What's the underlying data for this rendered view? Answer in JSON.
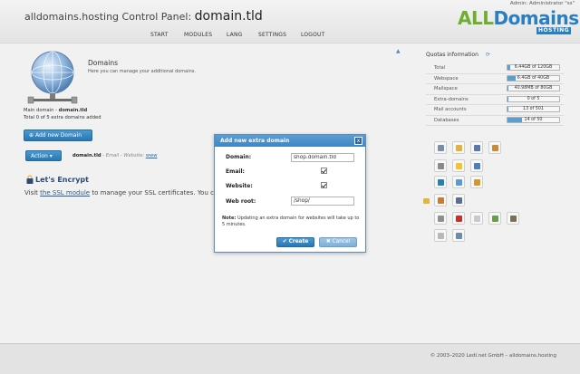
{
  "header": {
    "title_prefix": "alldomains.hosting Control Panel:",
    "title_domain": "domain.tld",
    "user_info": "Admin: Administrator \"ss\"",
    "logo_part1": "ALL",
    "logo_part2": "Domains",
    "logo_sub": "HOSTING"
  },
  "nav": {
    "items": [
      "START",
      "MODULES",
      "LANG",
      "SETTINGS",
      "LOGOUT"
    ]
  },
  "domains": {
    "title": "Domains",
    "description": "Here you can manage your additional domains.",
    "main_domain_label": "Main domain -",
    "main_domain_value": "domain.tld",
    "total_line": "Total 0 of 5 extra domains added",
    "add_button": "Add new Domain",
    "action_button": "Action",
    "row_domain": "domain.tld",
    "row_meta": "- Email - Website:",
    "row_www": "www"
  },
  "letsencrypt": {
    "title": "Let's Encrypt",
    "text_prefix": "Visit",
    "link": "the SSL module",
    "text_suffix": "to manage your SSL certificates. You can"
  },
  "quotas": {
    "title": "Quotas information",
    "rows": [
      {
        "label": "Total",
        "value": "6.44GB of 120GB",
        "fill": 0.054
      },
      {
        "label": "Webspace",
        "value": "6.4GB of 40GB",
        "fill": 0.16
      },
      {
        "label": "Mailspace",
        "value": "40.98MB of 80GB",
        "fill": 0.005
      },
      {
        "label": "Extra-domains",
        "value": "0 of 5",
        "fill": 0.0
      },
      {
        "label": "Mail accounts",
        "value": "13 of 501",
        "fill": 0.026
      },
      {
        "label": "Databases",
        "value": "14 of 50",
        "fill": 0.28
      }
    ]
  },
  "tools": [
    {
      "name": "users-icon",
      "color": "#7a8fa6"
    },
    {
      "name": "folder-icon",
      "color": "#e2b23d"
    },
    {
      "name": "settings-icon",
      "color": "#5a78a8"
    },
    {
      "name": "package-icon",
      "color": "#c98a3a"
    },
    {
      "name": "tools-icon",
      "color": "#8a8a8a"
    },
    {
      "name": "bulb-icon",
      "color": "#f2c530"
    },
    {
      "name": "network-icon",
      "color": "#4d7fb8"
    },
    {
      "name": "wordpress-icon",
      "color": "#2b7fb0"
    },
    {
      "name": "globe-icon",
      "color": "#5b9bd5"
    },
    {
      "name": "lock-icon",
      "color": "#d09a2a"
    },
    {
      "name": "paint-icon",
      "color": "#c77b35"
    },
    {
      "name": "blocks-icon",
      "color": "#5a6f8e"
    },
    {
      "name": "database-icon",
      "color": "#8e8e8e"
    },
    {
      "name": "delete-icon",
      "color": "#c8302c"
    },
    {
      "name": "document-icon",
      "color": "#c9c9c9"
    },
    {
      "name": "chart-icon",
      "color": "#6a9d4a"
    },
    {
      "name": "image-icon",
      "color": "#7b6f56"
    },
    {
      "name": "notes-icon",
      "color": "#b8b8b8"
    },
    {
      "name": "search-icon",
      "color": "#6a8cae"
    }
  ],
  "footer": {
    "copyright": "© 2003–2020 LedI.net GmbH – alldomains.hosting"
  },
  "modal": {
    "title": "Add new extra domain",
    "close": "x",
    "domain_label": "Domain:",
    "domain_value": "shop.domain.tld",
    "email_label": "Email:",
    "website_label": "Website:",
    "webroot_label": "Web root:",
    "webroot_value": "/shop/",
    "note_label": "Note:",
    "note_text": "Updating an extra domain for websites will take up to 5 minutes.",
    "create_button": "Create",
    "cancel_button": "Cancel"
  }
}
